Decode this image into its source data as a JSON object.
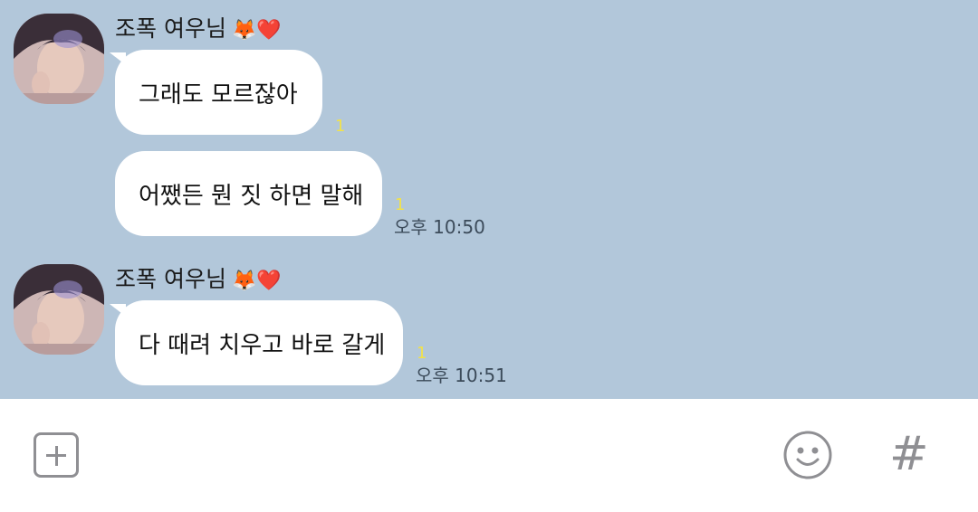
{
  "chat": {
    "background_color": "#b2c7da",
    "groups": [
      {
        "sender_name": "조폭 여우님",
        "sender_emoji": "🦊❤️",
        "messages": [
          {
            "text": "그래도 모르잖아",
            "unread": "1",
            "time": ""
          },
          {
            "text": "어쨌든 뭔 짓 하면 말해",
            "unread": "1",
            "time": "오후 10:50"
          }
        ]
      },
      {
        "sender_name": "조폭 여우님",
        "sender_emoji": "🦊❤️",
        "messages": [
          {
            "text": "다 때려 치우고 바로 갈게",
            "unread": "1",
            "time": "오후 10:51"
          }
        ]
      }
    ]
  },
  "input_bar": {
    "icons": [
      "plus-icon",
      "emoticon-icon",
      "hash-icon"
    ],
    "hash_glyph": "#"
  }
}
